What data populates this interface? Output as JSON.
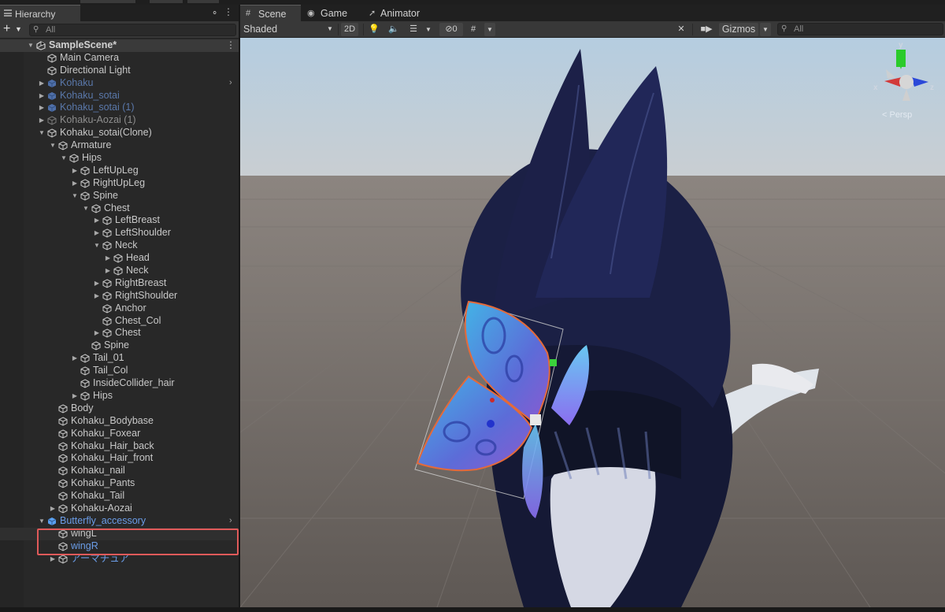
{
  "hierarchy": {
    "title": "Hierarchy",
    "search_placeholder": "All",
    "rows": [
      {
        "label": "SampleScene*",
        "depth": 0,
        "arrow": "down",
        "icon": "unity",
        "kind": "scene"
      },
      {
        "label": "Main Camera",
        "depth": 1,
        "arrow": "",
        "icon": "cube",
        "kind": "normal"
      },
      {
        "label": "Directional Light",
        "depth": 1,
        "arrow": "",
        "icon": "cube",
        "kind": "normal"
      },
      {
        "label": "Kohaku",
        "depth": 1,
        "arrow": "right",
        "icon": "prefab",
        "kind": "prefab-dim",
        "chev": true
      },
      {
        "label": "Kohaku_sotai",
        "depth": 1,
        "arrow": "right",
        "icon": "prefab",
        "kind": "prefab-dim"
      },
      {
        "label": "Kohaku_sotai (1)",
        "depth": 1,
        "arrow": "right",
        "icon": "prefab",
        "kind": "prefab-dim"
      },
      {
        "label": "Kohaku-Aozai (1)",
        "depth": 1,
        "arrow": "right",
        "icon": "cube-dim",
        "kind": "dim"
      },
      {
        "label": "Kohaku_sotai(Clone)",
        "depth": 1,
        "arrow": "down",
        "icon": "cube",
        "kind": "normal"
      },
      {
        "label": "Armature",
        "depth": 2,
        "arrow": "down",
        "icon": "cube",
        "kind": "normal"
      },
      {
        "label": "Hips",
        "depth": 3,
        "arrow": "down",
        "icon": "cube",
        "kind": "normal"
      },
      {
        "label": "LeftUpLeg",
        "depth": 4,
        "arrow": "right",
        "icon": "cube",
        "kind": "normal"
      },
      {
        "label": "RightUpLeg",
        "depth": 4,
        "arrow": "right",
        "icon": "cube",
        "kind": "normal"
      },
      {
        "label": "Spine",
        "depth": 4,
        "arrow": "down",
        "icon": "cube",
        "kind": "normal"
      },
      {
        "label": "Chest",
        "depth": 5,
        "arrow": "down",
        "icon": "cube",
        "kind": "normal"
      },
      {
        "label": "LeftBreast",
        "depth": 6,
        "arrow": "right",
        "icon": "cube",
        "kind": "normal"
      },
      {
        "label": "LeftShoulder",
        "depth": 6,
        "arrow": "right",
        "icon": "cube",
        "kind": "normal"
      },
      {
        "label": "Neck",
        "depth": 6,
        "arrow": "down",
        "icon": "cube",
        "kind": "normal"
      },
      {
        "label": "Head",
        "depth": 7,
        "arrow": "right",
        "icon": "cube",
        "kind": "normal"
      },
      {
        "label": "Neck",
        "depth": 7,
        "arrow": "right",
        "icon": "cube",
        "kind": "normal"
      },
      {
        "label": "RightBreast",
        "depth": 6,
        "arrow": "right",
        "icon": "cube",
        "kind": "normal"
      },
      {
        "label": "RightShoulder",
        "depth": 6,
        "arrow": "right",
        "icon": "cube",
        "kind": "normal"
      },
      {
        "label": "Anchor",
        "depth": 6,
        "arrow": "",
        "icon": "cube",
        "kind": "normal"
      },
      {
        "label": "Chest_Col",
        "depth": 6,
        "arrow": "",
        "icon": "cube",
        "kind": "normal"
      },
      {
        "label": "Chest",
        "depth": 6,
        "arrow": "right",
        "icon": "cube",
        "kind": "normal"
      },
      {
        "label": "Spine",
        "depth": 5,
        "arrow": "",
        "icon": "cube",
        "kind": "normal"
      },
      {
        "label": "Tail_01",
        "depth": 4,
        "arrow": "right",
        "icon": "cube",
        "kind": "normal"
      },
      {
        "label": "Tail_Col",
        "depth": 4,
        "arrow": "",
        "icon": "cube",
        "kind": "normal"
      },
      {
        "label": "InsideCollider_hair",
        "depth": 4,
        "arrow": "",
        "icon": "cube",
        "kind": "normal"
      },
      {
        "label": "Hips",
        "depth": 4,
        "arrow": "right",
        "icon": "cube",
        "kind": "normal"
      },
      {
        "label": "Body",
        "depth": 2,
        "arrow": "",
        "icon": "cube",
        "kind": "normal"
      },
      {
        "label": "Kohaku_Bodybase",
        "depth": 2,
        "arrow": "",
        "icon": "cube",
        "kind": "normal"
      },
      {
        "label": "Kohaku_Foxear",
        "depth": 2,
        "arrow": "",
        "icon": "cube",
        "kind": "normal"
      },
      {
        "label": "Kohaku_Hair_back",
        "depth": 2,
        "arrow": "",
        "icon": "cube",
        "kind": "normal"
      },
      {
        "label": "Kohaku_Hair_front",
        "depth": 2,
        "arrow": "",
        "icon": "cube",
        "kind": "normal"
      },
      {
        "label": "Kohaku_nail",
        "depth": 2,
        "arrow": "",
        "icon": "cube",
        "kind": "normal"
      },
      {
        "label": "Kohaku_Pants",
        "depth": 2,
        "arrow": "",
        "icon": "cube",
        "kind": "normal"
      },
      {
        "label": "Kohaku_Tail",
        "depth": 2,
        "arrow": "",
        "icon": "cube",
        "kind": "normal"
      },
      {
        "label": "Kohaku-Aozai",
        "depth": 2,
        "arrow": "right",
        "icon": "cube",
        "kind": "normal"
      },
      {
        "label": "Butterfly_accessory",
        "depth": 1,
        "arrow": "down",
        "icon": "prefab",
        "kind": "prefab",
        "chev": true
      },
      {
        "label": "wingL",
        "depth": 2,
        "arrow": "",
        "icon": "cube",
        "kind": "normal",
        "highlight": true
      },
      {
        "label": "wingR",
        "depth": 2,
        "arrow": "",
        "icon": "cube",
        "kind": "prefab"
      },
      {
        "label": "アーマチュア",
        "depth": 2,
        "arrow": "right",
        "icon": "cube",
        "kind": "prefab"
      }
    ]
  },
  "scene": {
    "tabs": [
      {
        "label": "Scene",
        "icon": "grid-icon",
        "active": true
      },
      {
        "label": "Game",
        "icon": "gamepad-icon",
        "active": false
      },
      {
        "label": "Animator",
        "icon": "animator-icon",
        "active": false
      }
    ],
    "shading_mode": "Shaded",
    "mode_2d": "2D",
    "hidden_count": "0",
    "gizmos_label": "Gizmos",
    "search_placeholder": "All",
    "gizmo_axes": {
      "y": "y",
      "x": "x",
      "z": "z"
    },
    "persp_label": "< Persp"
  },
  "colors": {
    "accent_selection": "#e05a5a",
    "prefab_blue": "#6b9de8",
    "panel_bg": "#282828"
  }
}
